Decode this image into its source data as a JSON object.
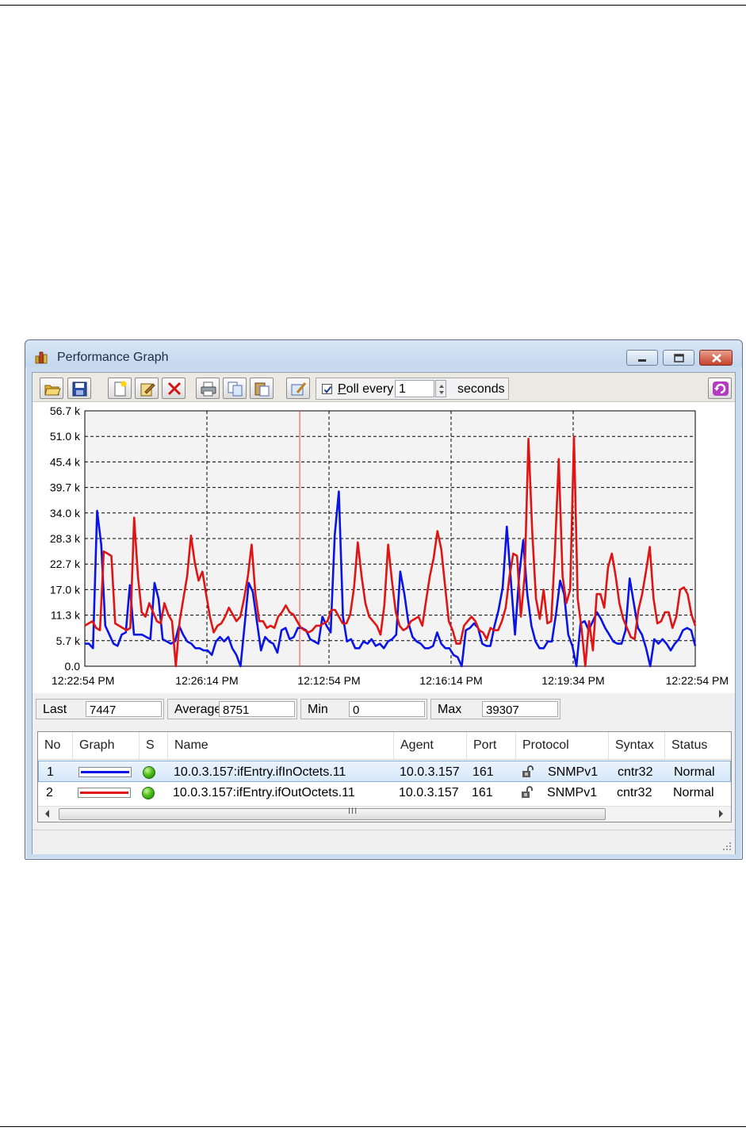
{
  "window": {
    "title": "Performance Graph",
    "app_icon": "bar-chart-icon"
  },
  "toolbar": {
    "buttons": [
      "open-folder-icon",
      "save-icon",
      "new-icon",
      "edit-icon",
      "delete-icon",
      "print-icon",
      "copy-icon",
      "paste-icon",
      "properties-icon"
    ],
    "poll_checked": true,
    "poll_label_underlined": "P",
    "poll_label_rest": "oll every",
    "poll_value": "1",
    "seconds_label": "seconds",
    "refresh_icon": "refresh-icon"
  },
  "chart_data": {
    "type": "line",
    "y_tick_labels": [
      "0.0",
      "5.7 k",
      "11.3 k",
      "17.0 k",
      "22.7 k",
      "28.3 k",
      "34.0 k",
      "39.7 k",
      "45.4 k",
      "51.0 k",
      "56.7 k"
    ],
    "ylim": [
      0,
      56700
    ],
    "x_tick_labels": [
      "12:22:54 PM",
      "12:26:14 PM",
      "12:12:54 PM",
      "12:16:14 PM",
      "12:19:34 PM",
      "12:22:54 PM"
    ],
    "grid": true,
    "cursor_position_fraction": 0.352,
    "series": [
      {
        "color": "#0a14e6",
        "values": [
          5000,
          5000,
          4000,
          34500,
          27000,
          9000,
          7000,
          5000,
          4500,
          7000,
          7500,
          18000,
          7000,
          7000,
          7000,
          6500,
          6000,
          18500,
          15000,
          6000,
          5500,
          5000,
          5500,
          9000,
          7000,
          5500,
          5000,
          4000,
          4000,
          3500,
          3500,
          2500,
          5500,
          6500,
          5500,
          6500,
          4000,
          2500,
          0,
          9000,
          18500,
          16500,
          10000,
          3500,
          6500,
          5500,
          5000,
          3000,
          8000,
          8500,
          6000,
          6500,
          8500,
          8500,
          8000,
          6000,
          5500,
          5000,
          11000,
          9000,
          7500,
          29000,
          38800,
          11000,
          5500,
          6000,
          4000,
          4000,
          5500,
          5000,
          6000,
          4500,
          5000,
          4000,
          5500,
          6000,
          7000,
          21000,
          16000,
          9500,
          6500,
          5500,
          5000,
          4000,
          4000,
          4500,
          7500,
          5000,
          4000,
          4000,
          2500,
          2000,
          0,
          8000,
          8500,
          9500,
          8500,
          5000,
          4500,
          4500,
          9000,
          12500,
          17500,
          31000,
          19000,
          7000,
          20000,
          28000,
          16000,
          9000,
          5500,
          4000,
          4000,
          5500,
          5500,
          11500,
          19000,
          16000,
          7000,
          4500,
          0,
          9500,
          10000,
          8000,
          10000,
          12000,
          10500,
          8500,
          7000,
          5500,
          5000,
          5000,
          8000,
          19500,
          14000,
          8500,
          7000,
          4000,
          0,
          6000,
          5000,
          6000,
          5000,
          3500,
          5000,
          6000,
          8000,
          8500,
          8000,
          4500
        ]
      },
      {
        "color": "#e11414",
        "values": [
          9000,
          9500,
          10000,
          8500,
          8000,
          25500,
          25000,
          24500,
          9500,
          9000,
          8500,
          8000,
          8500,
          33000,
          20000,
          12000,
          11000,
          14000,
          12000,
          10000,
          9500,
          14000,
          11500,
          10000,
          0,
          10000,
          15000,
          20000,
          29000,
          23000,
          19000,
          21000,
          16000,
          11000,
          7500,
          9000,
          9500,
          11000,
          13000,
          11500,
          10000,
          11000,
          15000,
          20000,
          27000,
          16000,
          10000,
          10000,
          8500,
          9000,
          8500,
          11000,
          12000,
          13500,
          12000,
          11500,
          10000,
          8500,
          8000,
          7500,
          8000,
          9000,
          9000,
          9500,
          10000,
          12500,
          12500,
          11000,
          9500,
          9500,
          11500,
          17500,
          27500,
          20000,
          14000,
          11000,
          10000,
          9000,
          7000,
          13500,
          27000,
          19000,
          12000,
          9000,
          8000,
          8500,
          10000,
          10500,
          11000,
          9000,
          14500,
          20000,
          24000,
          30000,
          26000,
          18000,
          10000,
          8000,
          5000,
          5000,
          9000,
          10000,
          11000,
          10000,
          8000,
          7500,
          6000,
          8500,
          8000,
          8000,
          10000,
          13000,
          20000,
          25000,
          24500,
          11000,
          20000,
          50500,
          30000,
          15000,
          10500,
          17000,
          9500,
          10000,
          25500,
          46000,
          20000,
          14000,
          17000,
          51000,
          15000,
          8500,
          0,
          10000,
          3500,
          16000,
          16000,
          13000,
          22000,
          25000,
          20000,
          14000,
          10500,
          8500,
          6500,
          6000,
          12500,
          16000,
          21000,
          26500,
          15000,
          9500,
          10000,
          12000,
          12000,
          8500,
          11000,
          17000,
          17500,
          16000,
          11500,
          9000
        ]
      }
    ]
  },
  "stats": {
    "last_label": "Last",
    "last_value": "7447",
    "average_label": "Average",
    "average_value": "8751",
    "min_label": "Min",
    "min_value": "0",
    "max_label": "Max",
    "max_value": "39307"
  },
  "grid": {
    "columns": [
      "No",
      "Graph",
      "S",
      "Name",
      "Agent",
      "Port",
      "Protocol",
      "Syntax",
      "Status"
    ],
    "rows": [
      {
        "no": "1",
        "graph_color": "#0a14e6",
        "status_icon": "green-status-icon",
        "name": "10.0.3.157:ifEntry.ifInOctets.11",
        "agent": "10.0.3.157",
        "port": "161",
        "protocol_icon": "lock-icon",
        "protocol": "SNMPv1",
        "syntax": "cntr32",
        "status": "Normal"
      },
      {
        "no": "2",
        "graph_color": "#e11414",
        "status_icon": "green-status-icon",
        "name": "10.0.3.157:ifEntry.ifOutOctets.11",
        "agent": "10.0.3.157",
        "port": "161",
        "protocol_icon": "lock-icon",
        "protocol": "SNMPv1",
        "syntax": "cntr32",
        "status": "Normal"
      }
    ],
    "scroll_grip": "III"
  }
}
